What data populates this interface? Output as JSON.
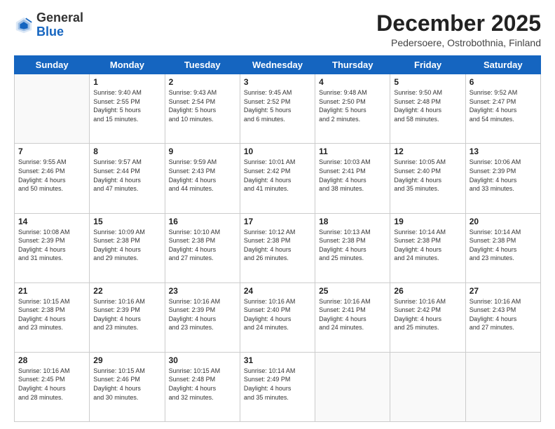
{
  "header": {
    "logo_general": "General",
    "logo_blue": "Blue",
    "month_title": "December 2025",
    "subtitle": "Pedersoere, Ostrobothnia, Finland"
  },
  "days_of_week": [
    "Sunday",
    "Monday",
    "Tuesday",
    "Wednesday",
    "Thursday",
    "Friday",
    "Saturday"
  ],
  "weeks": [
    [
      {
        "day": "",
        "info": ""
      },
      {
        "day": "1",
        "info": "Sunrise: 9:40 AM\nSunset: 2:55 PM\nDaylight: 5 hours\nand 15 minutes."
      },
      {
        "day": "2",
        "info": "Sunrise: 9:43 AM\nSunset: 2:54 PM\nDaylight: 5 hours\nand 10 minutes."
      },
      {
        "day": "3",
        "info": "Sunrise: 9:45 AM\nSunset: 2:52 PM\nDaylight: 5 hours\nand 6 minutes."
      },
      {
        "day": "4",
        "info": "Sunrise: 9:48 AM\nSunset: 2:50 PM\nDaylight: 5 hours\nand 2 minutes."
      },
      {
        "day": "5",
        "info": "Sunrise: 9:50 AM\nSunset: 2:48 PM\nDaylight: 4 hours\nand 58 minutes."
      },
      {
        "day": "6",
        "info": "Sunrise: 9:52 AM\nSunset: 2:47 PM\nDaylight: 4 hours\nand 54 minutes."
      }
    ],
    [
      {
        "day": "7",
        "info": "Sunrise: 9:55 AM\nSunset: 2:46 PM\nDaylight: 4 hours\nand 50 minutes."
      },
      {
        "day": "8",
        "info": "Sunrise: 9:57 AM\nSunset: 2:44 PM\nDaylight: 4 hours\nand 47 minutes."
      },
      {
        "day": "9",
        "info": "Sunrise: 9:59 AM\nSunset: 2:43 PM\nDaylight: 4 hours\nand 44 minutes."
      },
      {
        "day": "10",
        "info": "Sunrise: 10:01 AM\nSunset: 2:42 PM\nDaylight: 4 hours\nand 41 minutes."
      },
      {
        "day": "11",
        "info": "Sunrise: 10:03 AM\nSunset: 2:41 PM\nDaylight: 4 hours\nand 38 minutes."
      },
      {
        "day": "12",
        "info": "Sunrise: 10:05 AM\nSunset: 2:40 PM\nDaylight: 4 hours\nand 35 minutes."
      },
      {
        "day": "13",
        "info": "Sunrise: 10:06 AM\nSunset: 2:39 PM\nDaylight: 4 hours\nand 33 minutes."
      }
    ],
    [
      {
        "day": "14",
        "info": "Sunrise: 10:08 AM\nSunset: 2:39 PM\nDaylight: 4 hours\nand 31 minutes."
      },
      {
        "day": "15",
        "info": "Sunrise: 10:09 AM\nSunset: 2:38 PM\nDaylight: 4 hours\nand 29 minutes."
      },
      {
        "day": "16",
        "info": "Sunrise: 10:10 AM\nSunset: 2:38 PM\nDaylight: 4 hours\nand 27 minutes."
      },
      {
        "day": "17",
        "info": "Sunrise: 10:12 AM\nSunset: 2:38 PM\nDaylight: 4 hours\nand 26 minutes."
      },
      {
        "day": "18",
        "info": "Sunrise: 10:13 AM\nSunset: 2:38 PM\nDaylight: 4 hours\nand 25 minutes."
      },
      {
        "day": "19",
        "info": "Sunrise: 10:14 AM\nSunset: 2:38 PM\nDaylight: 4 hours\nand 24 minutes."
      },
      {
        "day": "20",
        "info": "Sunrise: 10:14 AM\nSunset: 2:38 PM\nDaylight: 4 hours\nand 23 minutes."
      }
    ],
    [
      {
        "day": "21",
        "info": "Sunrise: 10:15 AM\nSunset: 2:38 PM\nDaylight: 4 hours\nand 23 minutes."
      },
      {
        "day": "22",
        "info": "Sunrise: 10:16 AM\nSunset: 2:39 PM\nDaylight: 4 hours\nand 23 minutes."
      },
      {
        "day": "23",
        "info": "Sunrise: 10:16 AM\nSunset: 2:39 PM\nDaylight: 4 hours\nand 23 minutes."
      },
      {
        "day": "24",
        "info": "Sunrise: 10:16 AM\nSunset: 2:40 PM\nDaylight: 4 hours\nand 24 minutes."
      },
      {
        "day": "25",
        "info": "Sunrise: 10:16 AM\nSunset: 2:41 PM\nDaylight: 4 hours\nand 24 minutes."
      },
      {
        "day": "26",
        "info": "Sunrise: 10:16 AM\nSunset: 2:42 PM\nDaylight: 4 hours\nand 25 minutes."
      },
      {
        "day": "27",
        "info": "Sunrise: 10:16 AM\nSunset: 2:43 PM\nDaylight: 4 hours\nand 27 minutes."
      }
    ],
    [
      {
        "day": "28",
        "info": "Sunrise: 10:16 AM\nSunset: 2:45 PM\nDaylight: 4 hours\nand 28 minutes."
      },
      {
        "day": "29",
        "info": "Sunrise: 10:15 AM\nSunset: 2:46 PM\nDaylight: 4 hours\nand 30 minutes."
      },
      {
        "day": "30",
        "info": "Sunrise: 10:15 AM\nSunset: 2:48 PM\nDaylight: 4 hours\nand 32 minutes."
      },
      {
        "day": "31",
        "info": "Sunrise: 10:14 AM\nSunset: 2:49 PM\nDaylight: 4 hours\nand 35 minutes."
      },
      {
        "day": "",
        "info": ""
      },
      {
        "day": "",
        "info": ""
      },
      {
        "day": "",
        "info": ""
      }
    ]
  ]
}
